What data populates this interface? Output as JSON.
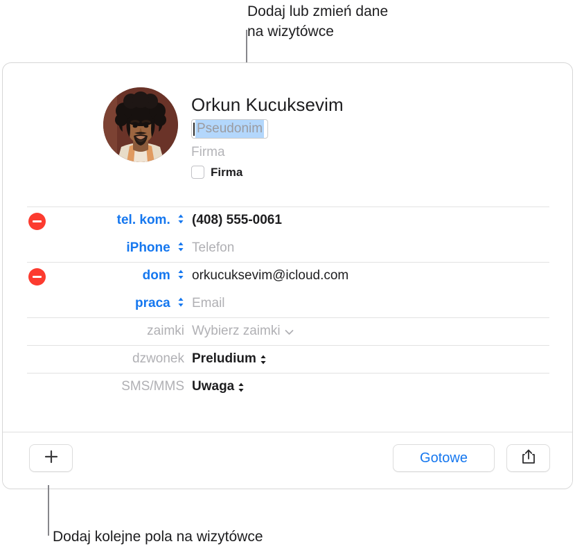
{
  "annotations": {
    "top": "Dodaj lub zmień dane\nna wizytówce",
    "bottom": "Dodaj kolejne pola na wizytówce"
  },
  "card": {
    "identity": {
      "avatar_alt": "contact-photo",
      "name": "Orkun  Kucuksevim",
      "nickname_placeholder": "Pseudonim",
      "company_placeholder": "Firma",
      "company_checkbox_label": "Firma",
      "company_checked": false
    },
    "field_groups": [
      {
        "name": "phone",
        "removable": true,
        "rows": [
          {
            "label": "tel. kom.",
            "label_style": "blue",
            "has_stepper": true,
            "value": "(408) 555-0061",
            "value_style": "strong"
          },
          {
            "label": "iPhone",
            "label_style": "blue",
            "has_stepper": true,
            "value": "Telefon",
            "value_style": "placeholder"
          }
        ]
      },
      {
        "name": "email",
        "removable": true,
        "rows": [
          {
            "label": "dom",
            "label_style": "blue",
            "has_stepper": true,
            "value": "orkucuksevim@icloud.com",
            "value_style": "plain"
          },
          {
            "label": "praca",
            "label_style": "blue",
            "has_stepper": true,
            "value": "Email",
            "value_style": "placeholder"
          }
        ]
      },
      {
        "name": "pronouns",
        "removable": false,
        "rows": [
          {
            "label": "zaimki",
            "label_style": "gray",
            "has_stepper": false,
            "value": "Wybierz zaimki",
            "value_style": "placeholder",
            "has_chevron": true
          }
        ]
      },
      {
        "name": "ringtone",
        "removable": false,
        "rows": [
          {
            "label": "dzwonek",
            "label_style": "gray",
            "has_stepper": false,
            "value": "Preludium",
            "value_style": "strong",
            "has_stepper_value": true
          }
        ]
      },
      {
        "name": "text-tone",
        "removable": false,
        "rows": [
          {
            "label": "SMS/MMS",
            "label_style": "gray",
            "has_stepper": false,
            "value": "Uwaga",
            "value_style": "strong",
            "has_stepper_value": true
          }
        ]
      }
    ],
    "toolbar": {
      "add_icon": "plus-icon",
      "done_label": "Gotowe",
      "share_icon": "share-icon"
    }
  },
  "colors": {
    "accent_blue": "#1577ef",
    "delete_red": "#fc3b2f",
    "placeholder_gray": "#b0b0b4",
    "selection_blue": "#b3d7fc",
    "leader_gray": "#86868b"
  }
}
